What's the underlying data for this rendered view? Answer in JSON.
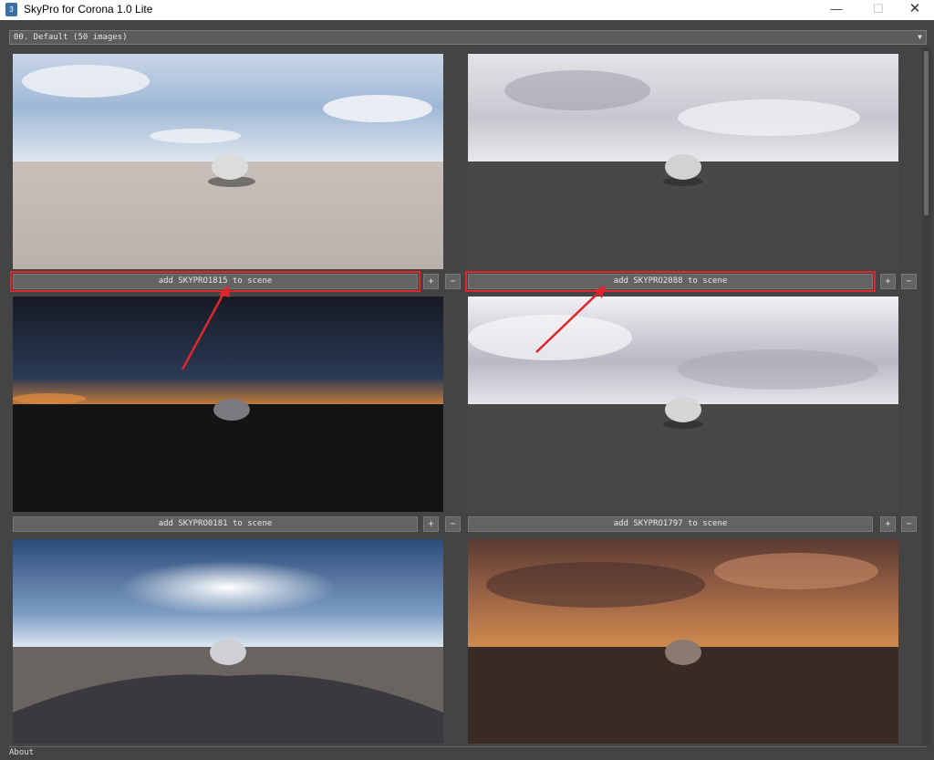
{
  "window": {
    "title": "SkyPro for Corona 1.0 Lite",
    "app_icon": "3",
    "minimize": "—",
    "maximize": "☐",
    "close": "✕"
  },
  "library": {
    "selected": "00. Default (50 images)",
    "arrow": "▼"
  },
  "items": [
    {
      "label": "add SKYPRO1815 to scene",
      "plus": "+",
      "minus": "−"
    },
    {
      "label": "add SKYPRO2088 to scene",
      "plus": "+",
      "minus": "−"
    },
    {
      "label": "add SKYPRO0181 to scene",
      "plus": "+",
      "minus": "−"
    },
    {
      "label": "add SKYPRO1797 to scene",
      "plus": "+",
      "minus": "−"
    }
  ],
  "footer": {
    "about": "About"
  },
  "colors": {
    "highlight": "#e0262d",
    "panel": "#444444",
    "button": "#636363"
  }
}
